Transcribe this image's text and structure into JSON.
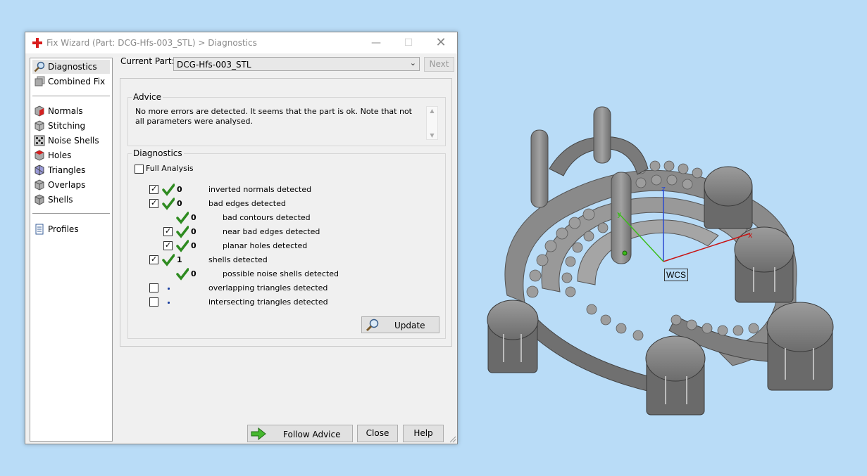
{
  "window": {
    "title": "Fix Wizard (Part: DCG-Hfs-003_STL) > Diagnostics",
    "minimize": "—",
    "maximize": "☐",
    "close": "✕"
  },
  "nav": {
    "items": [
      {
        "label": "Diagnostics",
        "icon": "magnifier-icon",
        "selected": true
      },
      {
        "label": "Combined Fix",
        "icon": "stacked-cubes-icon"
      },
      {
        "label": "Normals",
        "icon": "cube-red-face-icon"
      },
      {
        "label": "Stitching",
        "icon": "cube-icon"
      },
      {
        "label": "Noise Shells",
        "icon": "dice-icon"
      },
      {
        "label": "Holes",
        "icon": "cube-red-face-icon"
      },
      {
        "label": "Triangles",
        "icon": "cube-purple-icon"
      },
      {
        "label": "Overlaps",
        "icon": "cube-icon"
      },
      {
        "label": "Shells",
        "icon": "cube-icon"
      },
      {
        "label": "Profiles",
        "icon": "document-icon"
      }
    ]
  },
  "current_part": {
    "label": "Current Part:",
    "value": "DCG-Hfs-003_STL",
    "next_label": "Next"
  },
  "advice": {
    "heading": "Advice",
    "text": "No more errors are detected. It seems that the part is ok. Note that not all parameters were analysed."
  },
  "diagnostics": {
    "heading": "Diagnostics",
    "full_analysis_label": "Full Analysis",
    "rows": [
      {
        "checked": true,
        "ok": true,
        "count": "0",
        "text": "inverted normals detected"
      },
      {
        "checked": true,
        "ok": true,
        "count": "0",
        "text": "bad edges detected"
      },
      {
        "checkbox": false,
        "ok": true,
        "count": "0",
        "text": "bad contours detected"
      },
      {
        "checked": true,
        "ok": true,
        "count": "0",
        "text": "near bad edges detected"
      },
      {
        "checked": true,
        "ok": true,
        "count": "0",
        "text": "planar holes detected"
      },
      {
        "checked": true,
        "ok": true,
        "count": "1",
        "text": "shells detected"
      },
      {
        "checkbox": false,
        "ok": true,
        "count": "0",
        "text": "possible noise shells detected"
      },
      {
        "checked": false,
        "ok": false,
        "count": "",
        "text": "overlapping triangles detected"
      },
      {
        "checked": false,
        "ok": false,
        "count": "",
        "text": "intersecting triangles detected"
      }
    ],
    "update_label": "Update"
  },
  "footer": {
    "follow_advice_label": "Follow Advice",
    "close_label": "Close",
    "help_label": "Help"
  },
  "viewport": {
    "wcs_label": "WCS",
    "axis_x": "x",
    "axis_y": "y",
    "axis_z": "z"
  },
  "colors": {
    "background": "#b9dcf7",
    "check_green": "#2e8b20",
    "axis_red": "#c81414",
    "axis_green": "#3cbc1c",
    "axis_blue": "#2a4ad0",
    "part_gray": "#8a8a8a"
  }
}
